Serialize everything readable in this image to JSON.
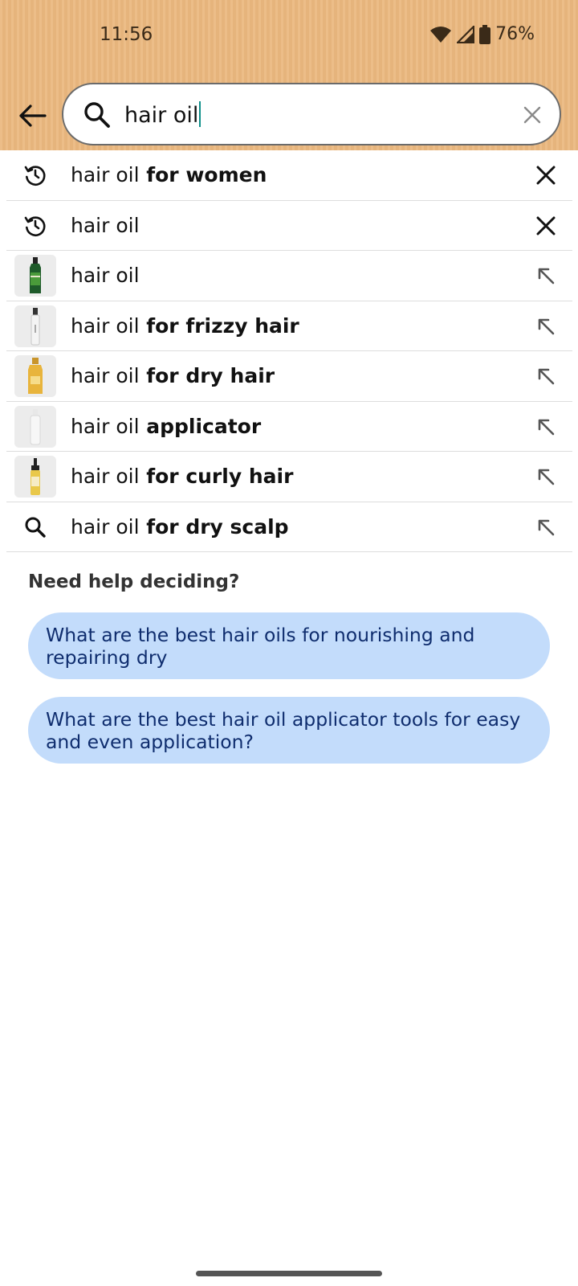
{
  "status_bar": {
    "time": "11:56",
    "battery": "76%",
    "icons": [
      "wifi-icon",
      "signal-icon",
      "battery-icon"
    ]
  },
  "search": {
    "back_icon": "back-arrow-icon",
    "query": "hair oil",
    "clear_icon": "close-icon"
  },
  "suggestions": [
    {
      "lead": "history-icon",
      "prefix": "hair oil",
      "suffix": " for women",
      "action": "remove-icon"
    },
    {
      "lead": "history-icon",
      "prefix": "hair oil",
      "suffix": "",
      "action": "remove-icon"
    },
    {
      "lead": "product-thumbnail-green-bottle",
      "prefix": "hair oil",
      "suffix": "",
      "action": "arrow-up-left-icon"
    },
    {
      "lead": "product-thumbnail-spray-bottle",
      "prefix": "hair oil",
      "suffix": " for frizzy hair",
      "action": "arrow-up-left-icon"
    },
    {
      "lead": "product-thumbnail-gold-bottle",
      "prefix": "hair oil",
      "suffix": " for dry hair",
      "action": "arrow-up-left-icon"
    },
    {
      "lead": "product-thumbnail-applicator",
      "prefix": "hair oil",
      "suffix": " applicator",
      "action": "arrow-up-left-icon"
    },
    {
      "lead": "product-thumbnail-dropper-bottle",
      "prefix": "hair oil",
      "suffix": " for curly hair",
      "action": "arrow-up-left-icon"
    },
    {
      "lead": "search-icon",
      "prefix": "hair oil",
      "suffix": " for dry scalp",
      "action": "arrow-up-left-icon"
    }
  ],
  "help": {
    "heading": "Need help deciding?",
    "questions": [
      "What are the best hair oils for nourishing and repairing dry",
      "What are the best hair oil applicator tools for easy and even application?"
    ]
  },
  "colors": {
    "header_bg": "#ebb87f",
    "pill_bg": "#c3dcfb",
    "pill_text": "#0f2d6e",
    "caret": "#0e8f8a"
  }
}
